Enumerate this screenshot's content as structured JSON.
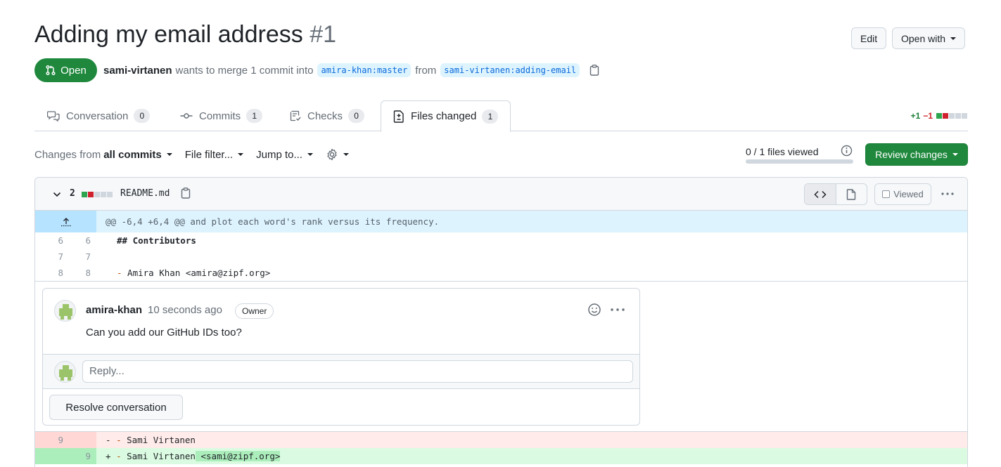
{
  "pr": {
    "title": "Adding my email address",
    "number": "#1",
    "state": "Open",
    "author": "sami-virtanen",
    "merge_text": "wants to merge 1 commit into",
    "base_branch": "amira-khan:master",
    "from_text": "from",
    "head_branch": "sami-virtanen:adding-email"
  },
  "header_buttons": {
    "edit": "Edit",
    "open_with": "Open with"
  },
  "tabs": [
    {
      "label": "Conversation",
      "count": "0",
      "icon": "comment-discussion-icon"
    },
    {
      "label": "Commits",
      "count": "1",
      "icon": "git-commit-icon"
    },
    {
      "label": "Checks",
      "count": "0",
      "icon": "checklist-icon"
    },
    {
      "label": "Files changed",
      "count": "1",
      "icon": "file-diff-icon"
    }
  ],
  "diffstat": {
    "additions": "+1",
    "deletions": "−1"
  },
  "toolbar": {
    "changes_from": "Changes from",
    "changes_value": "all commits",
    "file_filter": "File filter...",
    "jump_to": "Jump to...",
    "files_viewed": "0 / 1 files viewed",
    "files_viewed_fraction": 0,
    "review_changes": "Review changes"
  },
  "file": {
    "change_count": "2",
    "name": "README.md",
    "viewed_label": "Viewed",
    "hunk_header": "@@ -6,4 +6,4 @@ and plot each word's rank versus its frequency.",
    "context_lines": [
      {
        "old": "6",
        "new": "6",
        "text": "## Contributors"
      },
      {
        "old": "7",
        "new": "7",
        "text": ""
      },
      {
        "old": "8",
        "new": "8",
        "text": "- Amira Khan <amira@zipf.org>"
      }
    ],
    "deleted_line": {
      "old": "9",
      "sign": "-",
      "bullet": "-",
      "text": "Sami Virtanen"
    },
    "added_line": {
      "new": "9",
      "sign": "+",
      "bullet": "-",
      "text": "Sami Virtanen",
      "highlight": " <sami@zipf.org>"
    }
  },
  "comment": {
    "author": "amira-khan",
    "time": "10 seconds ago",
    "role": "Owner",
    "body": "Can you add our GitHub IDs too?",
    "reply_placeholder": "Reply...",
    "resolve_label": "Resolve conversation"
  },
  "colors": {
    "accent_green": "#1f883d",
    "link_blue": "#0969da",
    "deletion_red": "#cf222e"
  }
}
